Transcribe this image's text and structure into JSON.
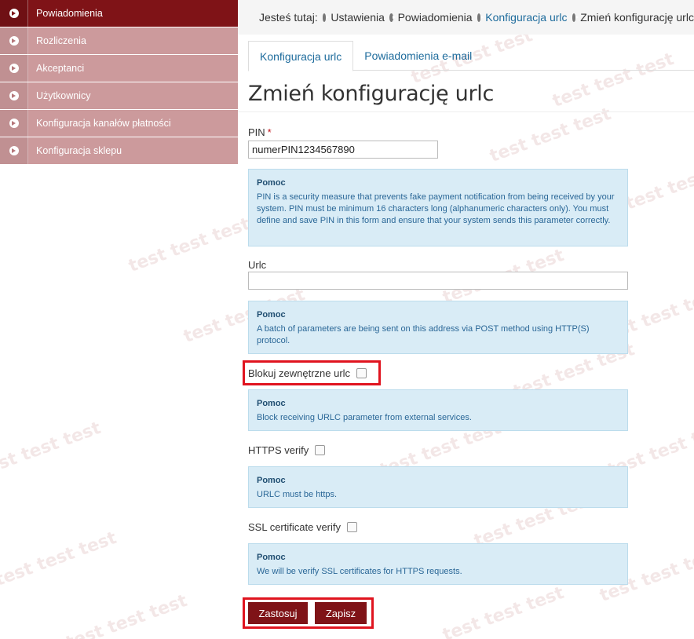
{
  "sidebar": {
    "items": [
      {
        "label": "Powiadomienia",
        "active": true
      },
      {
        "label": "Rozliczenia",
        "active": false
      },
      {
        "label": "Akceptanci",
        "active": false
      },
      {
        "label": "Użytkownicy",
        "active": false
      },
      {
        "label": "Konfiguracja kanałów płatności",
        "active": false
      },
      {
        "label": "Konfiguracja sklepu",
        "active": false
      }
    ]
  },
  "breadcrumb": {
    "prefix": "Jesteś tutaj:",
    "items": [
      "Ustawienia",
      "Powiadomienia",
      "Konfiguracja urlc",
      "Zmień konfigurację urlc"
    ]
  },
  "tabs": [
    {
      "label": "Konfiguracja urlc",
      "active": true
    },
    {
      "label": "Powiadomienia e-mail",
      "active": false
    }
  ],
  "page_title": "Zmień konfigurację urlc",
  "form": {
    "pin": {
      "label": "PIN",
      "required_mark": "*",
      "value": "numerPIN1234567890"
    },
    "pin_help": {
      "title": "Pomoc",
      "text": "PIN is a security measure that prevents fake payment notification from being received by your system. PIN must be minimum 16 characters long (alphanumeric characters only). You must define and save PIN in this form and ensure that your system sends this parameter correctly."
    },
    "urlc": {
      "label": "Urlc",
      "value": ""
    },
    "urlc_help": {
      "title": "Pomoc",
      "text": "A batch of parameters are being sent on this address via POST method using HTTP(S) protocol."
    },
    "block_external": {
      "label": "Blokuj zewnętrzne urlc",
      "checked": false
    },
    "block_help": {
      "title": "Pomoc",
      "text": "Block receiving URLC parameter from external services."
    },
    "https_verify": {
      "label": "HTTPS verify",
      "checked": false
    },
    "https_help": {
      "title": "Pomoc",
      "text": "URLC must be https."
    },
    "ssl_verify": {
      "label": "SSL certificate verify",
      "checked": false
    },
    "ssl_help": {
      "title": "Pomoc",
      "text": "We will be verify SSL certificates for HTTPS requests."
    }
  },
  "buttons": {
    "apply": "Zastosuj",
    "save": "Zapisz"
  },
  "watermark_text": "test test test",
  "colors": {
    "accent": "#7f1317",
    "sidebar_inactive": "#cc9a9c",
    "help_bg": "#d9ecf6",
    "highlight": "#e0141f",
    "link": "#1d6b9c"
  }
}
